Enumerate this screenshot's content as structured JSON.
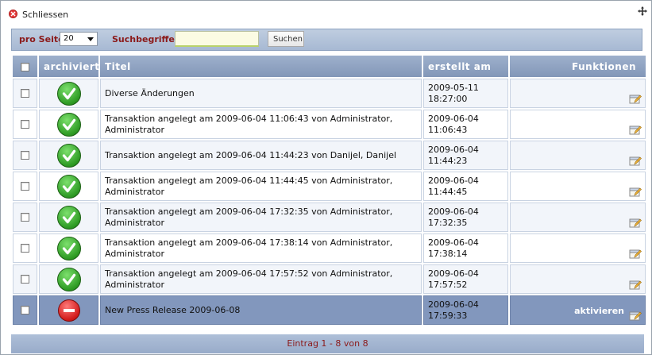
{
  "dialog": {
    "close_label": "Schliessen"
  },
  "toolbar": {
    "per_page_label": "pro Seite",
    "per_page_value": "20",
    "search_label": "Suchbegriffe",
    "search_value": "",
    "search_button": "Suchen"
  },
  "table": {
    "headers": {
      "archived": "archiviert",
      "title": "Titel",
      "created": "erstellt am",
      "functions": "Funktionen"
    },
    "rows": [
      {
        "archived": true,
        "title": "Diverse Änderungen",
        "date": "2009-05-11",
        "time": "18:27:00"
      },
      {
        "archived": true,
        "title": "Transaktion angelegt am 2009-06-04 11:06:43 von Administrator, Administrator",
        "date": "2009-06-04",
        "time": "11:06:43"
      },
      {
        "archived": true,
        "title": "Transaktion angelegt am 2009-06-04 11:44:23 von Danijel, Danijel",
        "date": "2009-06-04",
        "time": "11:44:23"
      },
      {
        "archived": true,
        "title": "Transaktion angelegt am 2009-06-04 11:44:45 von Administrator, Administrator",
        "date": "2009-06-04",
        "time": "11:44:45"
      },
      {
        "archived": true,
        "title": "Transaktion angelegt am 2009-06-04 17:32:35 von Administrator, Administrator",
        "date": "2009-06-04",
        "time": "17:32:35"
      },
      {
        "archived": true,
        "title": "Transaktion angelegt am 2009-06-04 17:38:14 von Administrator, Administrator",
        "date": "2009-06-04",
        "time": "17:38:14"
      },
      {
        "archived": true,
        "title": "Transaktion angelegt am 2009-06-04 17:57:52 von Administrator, Administrator",
        "date": "2009-06-04",
        "time": "17:57:52"
      },
      {
        "archived": false,
        "title": "New Press Release 2009-06-08",
        "date": "2009-06-04",
        "time": "17:59:33",
        "action": "aktivieren"
      }
    ]
  },
  "footer": {
    "summary": "Eintrag 1 - 8 von 8"
  },
  "colors": {
    "header": "#8297b8",
    "accent_text": "#8b1a1a",
    "selected_row": "#8297bd"
  }
}
